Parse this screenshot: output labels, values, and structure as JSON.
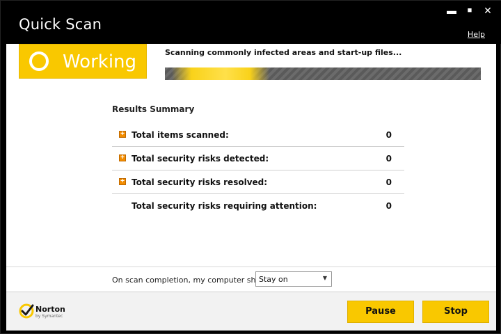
{
  "window": {
    "title": "Quick Scan",
    "help_label": "Help",
    "controls": {
      "minimize": "▬",
      "maximize": "■",
      "close": "✕"
    }
  },
  "status": {
    "label": "Working",
    "caption": "Scanning commonly infected areas and start-up files...",
    "icon": "status-circle-icon"
  },
  "results": {
    "title": "Results Summary",
    "rows": [
      {
        "label": "Total items scanned:",
        "value": "0",
        "expandable": true
      },
      {
        "label": "Total security risks detected:",
        "value": "0",
        "expandable": true
      },
      {
        "label": "Total security risks resolved:",
        "value": "0",
        "expandable": true
      },
      {
        "label": "Total security risks requiring attention:",
        "value": "0",
        "expandable": false
      }
    ]
  },
  "completion": {
    "label": "On scan completion, my computer should:",
    "selected": "Stay on"
  },
  "footer": {
    "brand": "Norton",
    "brand_sub": "by Symantec",
    "pause_label": "Pause",
    "stop_label": "Stop"
  },
  "colors": {
    "accent": "#f9c800",
    "expand": "#f28c00",
    "titlebar": "#000000"
  }
}
